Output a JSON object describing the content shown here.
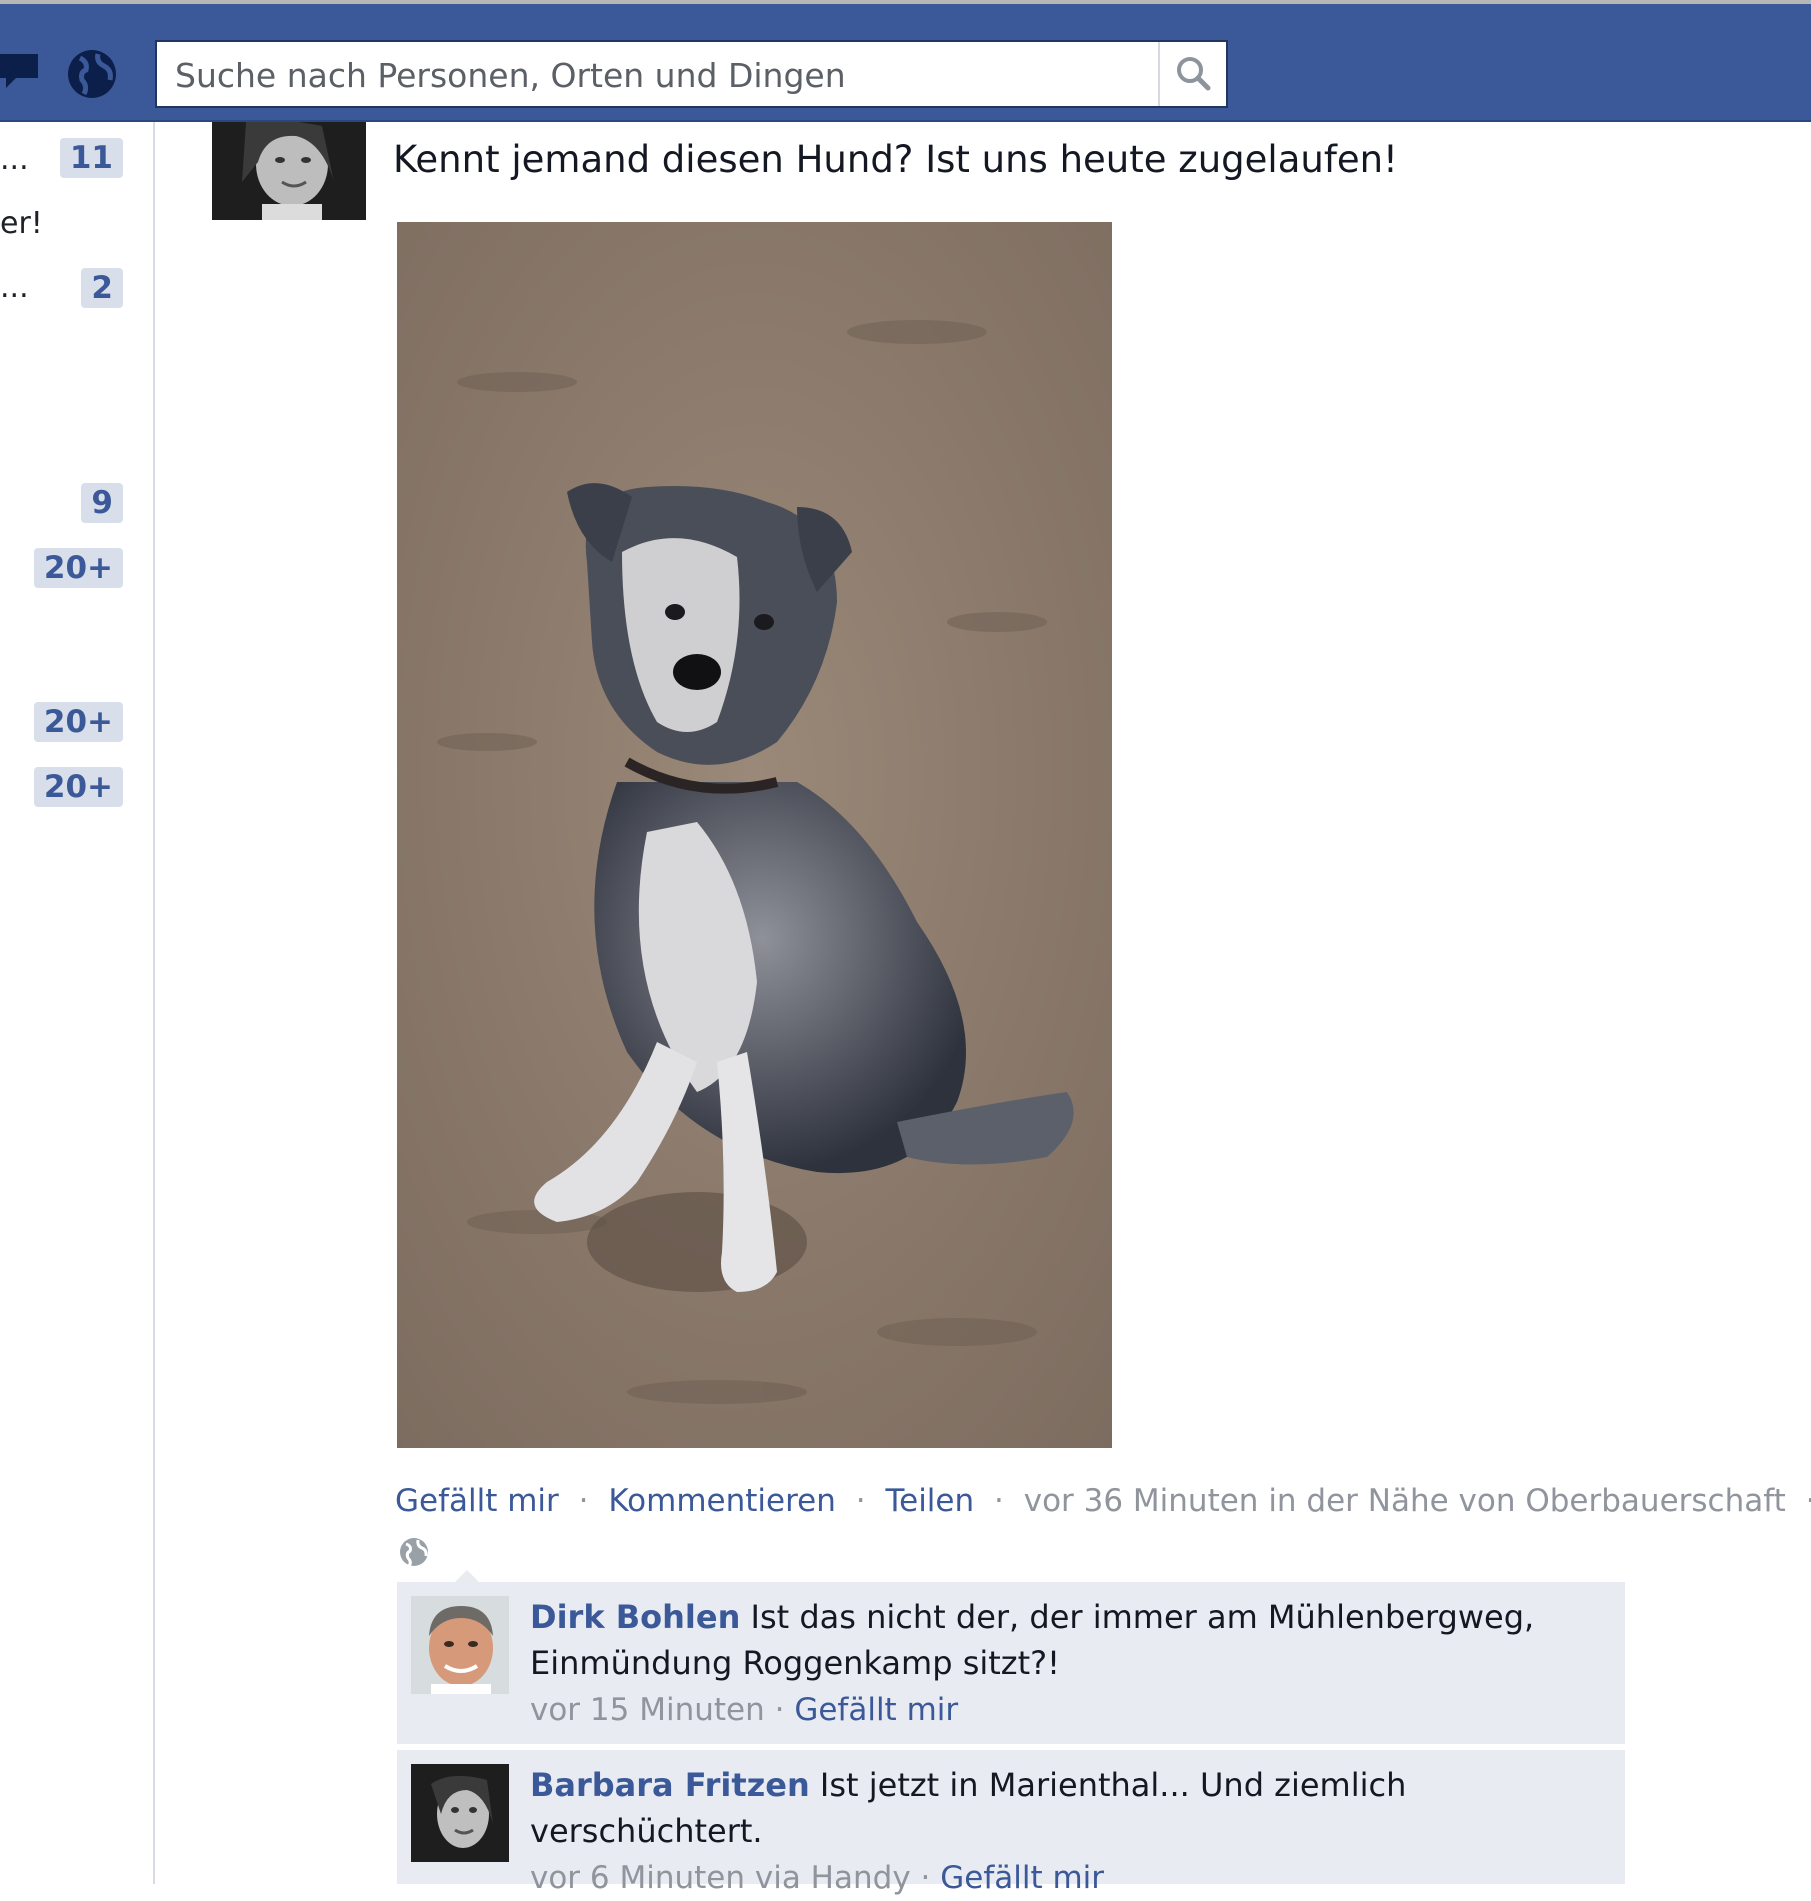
{
  "header": {
    "search_placeholder": "Suche nach Personen, Orten und Dingen"
  },
  "left_column": {
    "rows": [
      {
        "text": "...",
        "badge": "11"
      },
      {
        "text": "er!",
        "badge": ""
      },
      {
        "text": "...",
        "badge": "2"
      },
      {
        "text": "",
        "badge": "9"
      },
      {
        "text": "",
        "badge": "20+"
      },
      {
        "text": "",
        "badge": "20+"
      },
      {
        "text": "",
        "badge": "20+"
      }
    ]
  },
  "post": {
    "text": "Kennt jemand diesen Hund? Ist uns heute zugelaufen!",
    "actions": {
      "like": "Gefällt mir",
      "comment": "Kommentieren",
      "share": "Teilen",
      "timestamp": "vor 36 Minuten in der Nähe von Oberbauerschaft",
      "separator": "·"
    }
  },
  "comments": [
    {
      "author": "Dirk Bohlen",
      "text": "Ist das nicht der, der immer am Mühlenbergweg, Einmündung Roggenkamp sitzt?!",
      "time": "vor 15 Minuten",
      "like": "Gefällt mir"
    },
    {
      "author": "Barbara Fritzen",
      "text": "Ist jetzt in Marienthal... Und ziemlich verschüchtert.",
      "time": "vor 6 Minuten via Handy",
      "like": "Gefällt mir"
    }
  ],
  "colors": {
    "brand": "#3b5998",
    "badge_bg": "#d8dfea",
    "comment_bg": "#e9ebf2"
  },
  "icons": {
    "messages": "messages-icon",
    "notifications": "globe-icon",
    "search": "search-icon",
    "privacy": "globe-icon"
  }
}
